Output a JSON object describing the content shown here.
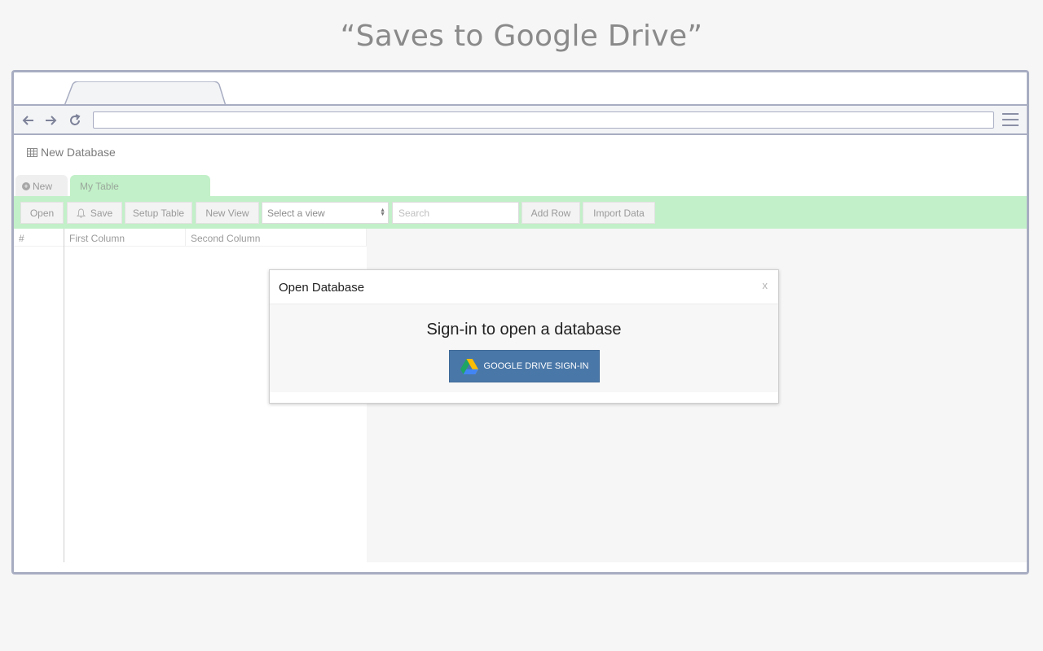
{
  "headline": "“Saves to Google Drive”",
  "browser": {
    "nav": {
      "back_icon": "arrow-left-icon",
      "forward_icon": "arrow-right-icon",
      "reload_icon": "reload-icon",
      "menu_icon": "hamburger-menu-icon"
    },
    "address_value": ""
  },
  "app": {
    "db_title": "New Database",
    "tabs": {
      "new_label": "New",
      "active_label": "My Table"
    },
    "toolbar": {
      "open": "Open",
      "save": "Save",
      "setup_table": "Setup Table",
      "new_view": "New View",
      "view_select": "Select a view",
      "search_placeholder": "Search",
      "add_row": "Add Row",
      "import_data": "Import Data"
    },
    "grid": {
      "columns": [
        "#",
        "First Column",
        "Second Column"
      ]
    }
  },
  "modal": {
    "title": "Open Database",
    "close": "x",
    "message": "Sign-in to open a database",
    "button": "GOOGLE DRIVE SIGN-IN"
  },
  "colors": {
    "accent_green": "#c2f0c8",
    "frame": "#a8adc2",
    "drive_button": "#4977a8"
  }
}
